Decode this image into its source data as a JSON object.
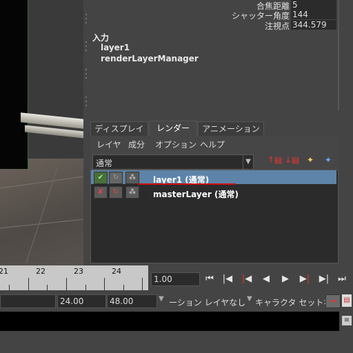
{
  "attributes": [
    {
      "label": "合焦距離",
      "value": "5"
    },
    {
      "label": "シャッター角度",
      "value": "144"
    },
    {
      "label": "注視点",
      "value": "344.579"
    }
  ],
  "inputs": {
    "heading": "入力",
    "connections": [
      "layer1",
      "renderLayerManager"
    ]
  },
  "tabs": [
    {
      "label": "ディスプレイ",
      "active": false
    },
    {
      "label": "レンダー",
      "active": true
    },
    {
      "label": "アニメーション",
      "active": false
    }
  ],
  "layer_menu": [
    "レイヤ",
    "成分",
    "オプション",
    "ヘルプ"
  ],
  "blend_mode": {
    "value": "通常"
  },
  "layers": [
    {
      "name": "layer1 (通常)",
      "selected": true
    },
    {
      "name": "masterLayer (通常)",
      "selected": false
    }
  ],
  "timeline": {
    "tick_labels": [
      "21",
      "22",
      "23",
      "24"
    ],
    "current_time": "1.00"
  },
  "range": {
    "fields": [
      "24.00",
      "48.00"
    ],
    "anim_layer": "ーション レイヤなし",
    "char_set": "キャラクタ セットなし"
  },
  "colors": {
    "selected_row": "#5d84a8",
    "underline": "#d01010",
    "panel_bg": "#444444"
  }
}
